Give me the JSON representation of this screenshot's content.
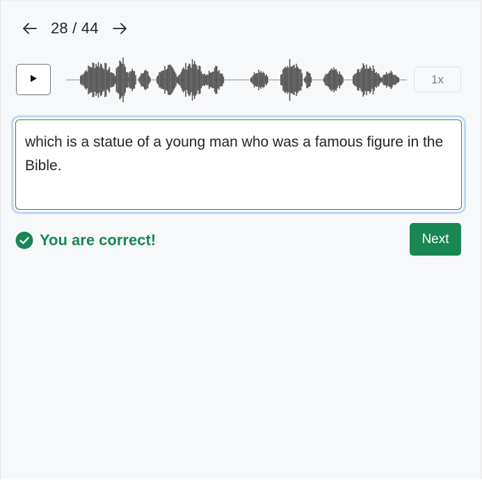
{
  "navigation": {
    "prev_icon": "arrow-left-icon",
    "next_icon": "arrow-right-icon",
    "counter": "28 / 44"
  },
  "player": {
    "play_icon": "play-icon",
    "speed_label": "1x",
    "waveform_color": "#595959"
  },
  "answer": {
    "text": "which is a statue of a young man who was a famous figure in the Bible."
  },
  "feedback": {
    "icon": "check-circle-icon",
    "message": "You are correct!",
    "color": "#1a8754"
  },
  "actions": {
    "next_label": "Next",
    "accent": "#198754"
  }
}
